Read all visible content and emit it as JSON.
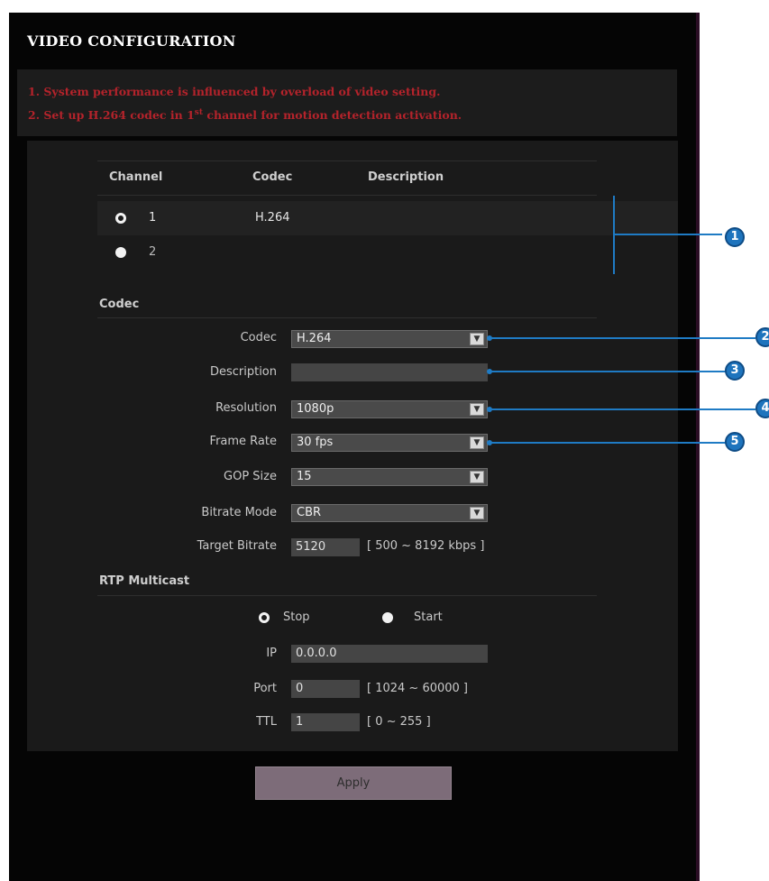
{
  "page": {
    "title": "VIDEO CONFIGURATION"
  },
  "notice": {
    "line1": "1. System performance is influenced by overload of video setting.",
    "line2_pre": "2. Set up H.264 codec in 1",
    "line2_sup": "st",
    "line2_post": " channel for motion detection activation."
  },
  "channel_table": {
    "headers": {
      "channel": "Channel",
      "codec": "Codec",
      "description": "Description"
    },
    "rows": [
      {
        "channel": "1",
        "codec": "H.264",
        "description": "",
        "selected": true
      },
      {
        "channel": "2",
        "codec": "",
        "description": "",
        "selected": false
      }
    ]
  },
  "codec_section": {
    "heading": "Codec",
    "codec": {
      "label": "Codec",
      "value": "H.264"
    },
    "description": {
      "label": "Description",
      "value": ""
    },
    "resolution": {
      "label": "Resolution",
      "value": "1080p"
    },
    "frame_rate": {
      "label": "Frame Rate",
      "value": "30 fps"
    },
    "gop_size": {
      "label": "GOP Size",
      "value": "15"
    },
    "bitrate_mode": {
      "label": "Bitrate Mode",
      "value": "CBR"
    },
    "target_bitrate": {
      "label": "Target Bitrate",
      "value": "5120",
      "range": "[ 500 ~ 8192 kbps ]"
    }
  },
  "rtp_section": {
    "heading": "RTP Multicast",
    "stop_label": "Stop",
    "start_label": "Start",
    "selected": "Stop",
    "ip": {
      "label": "IP",
      "value": "0.0.0.0"
    },
    "port": {
      "label": "Port",
      "value": "0",
      "range": "[ 1024 ~ 60000 ]"
    },
    "ttl": {
      "label": "TTL",
      "value": "1",
      "range": "[ 0 ~ 255 ]"
    }
  },
  "apply_label": "Apply",
  "callouts": [
    "1",
    "2",
    "3",
    "4",
    "5"
  ],
  "colors": {
    "notice_text": "#b4232b",
    "callout": "#1f7bc4",
    "apply_button": "#7d6c79",
    "background": "#050505"
  }
}
